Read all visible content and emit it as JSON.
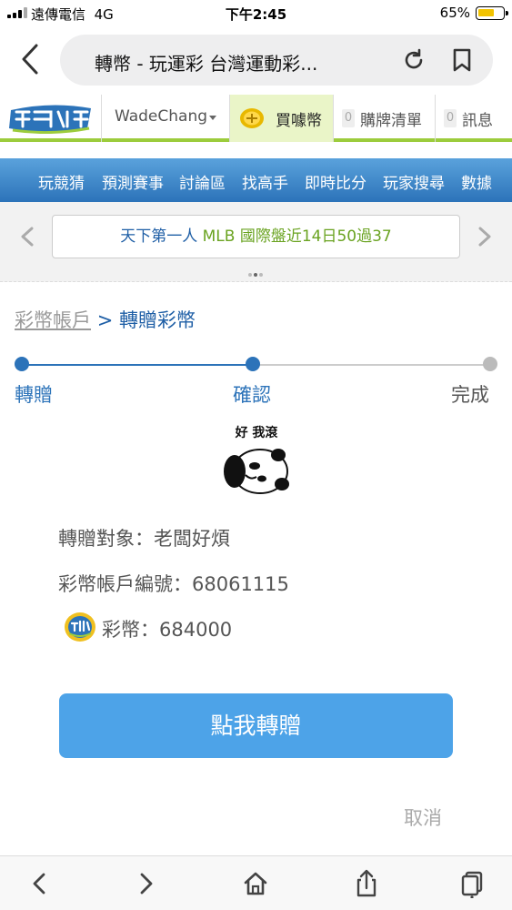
{
  "status_bar": {
    "carrier": "遠傳電信",
    "network": "4G",
    "time": "下午2:45",
    "battery": "65%"
  },
  "browser": {
    "url_title": "轉幣 - 玩運彩 台灣運動彩..."
  },
  "site_header": {
    "username": "WadeChang",
    "buy_label": "買噱幣",
    "list_count": "0",
    "list_label": "購牌清單",
    "msg_count": "0",
    "msg_label": "訊息"
  },
  "nav": {
    "items": [
      "玩競猜",
      "預測賽事",
      "討論區",
      "找高手",
      "即時比分",
      "玩家搜尋",
      "數據"
    ]
  },
  "ticker": {
    "text_a": "天下第一人 ",
    "text_b": "MLB 國際盤近14日50過37"
  },
  "breadcrumb": {
    "parent": "彩幣帳戶",
    "separator": ">",
    "current": "轉贈彩幣"
  },
  "steps": {
    "items": [
      "轉贈",
      "確認",
      "完成"
    ],
    "active_color": "#2c73b9",
    "inactive_color": "#bbbbbb"
  },
  "meme": {
    "caption": "好 我滾"
  },
  "transfer": {
    "target": "轉贈對象：老闆好煩",
    "account": "彩幣帳戶編號：68061115",
    "coins": "彩幣：684000"
  },
  "actions": {
    "confirm_label": "點我轉贈",
    "cancel_label": "取消"
  },
  "colors": {
    "brand_blue": "#2c73b9",
    "button_blue": "#4da3e8",
    "header_green": "#9ccc3c"
  }
}
